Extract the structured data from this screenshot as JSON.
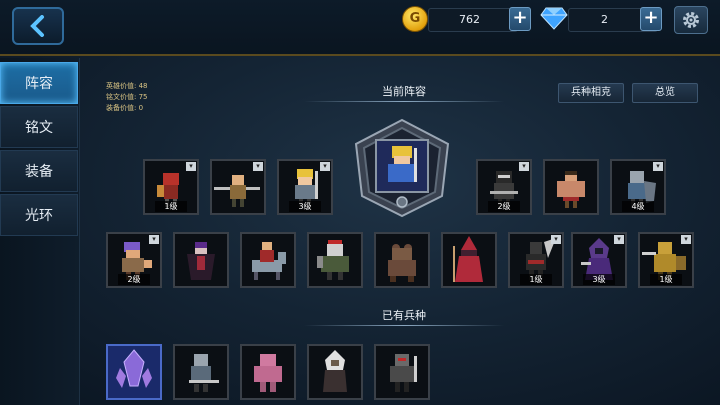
{
  "topbar": {
    "gold": {
      "value": "762",
      "icon": "G"
    },
    "gems": {
      "value": "2"
    },
    "plus": "+"
  },
  "sidebar": {
    "tabs": [
      {
        "label": "阵容",
        "active": true
      },
      {
        "label": "铭文",
        "active": false
      },
      {
        "label": "装备",
        "active": false
      },
      {
        "label": "光环",
        "active": false
      }
    ]
  },
  "stats": {
    "hero_value": "英雄价值: 48",
    "inscription_value": "铭文价值: 75",
    "equipment_value": "装备价值: 0"
  },
  "lineup": {
    "title": "当前阵容",
    "counter_button": "兵种相克",
    "overview_button": "总览",
    "row1_left": [
      {
        "icon": "red-knight-icon",
        "level": "1级"
      },
      {
        "icon": "spear-warrior-icon",
        "level": ""
      },
      {
        "icon": "blonde-knight-icon",
        "level": "3级"
      }
    ],
    "leader": {
      "icon": "leader-hero-icon"
    },
    "row1_right": [
      {
        "icon": "dark-ninja-icon",
        "level": "2级"
      },
      {
        "icon": "barbarian-icon",
        "level": ""
      },
      {
        "icon": "shield-soldier-icon",
        "level": "4级"
      }
    ],
    "row2": [
      {
        "icon": "purple-brawler-icon",
        "level": "2级"
      },
      {
        "icon": "vampire-icon",
        "level": ""
      },
      {
        "icon": "cavalry-icon",
        "level": ""
      },
      {
        "icon": "armored-orc-icon",
        "level": ""
      },
      {
        "icon": "bear-icon",
        "level": ""
      },
      {
        "icon": "red-mage-icon",
        "level": ""
      },
      {
        "icon": "dark-swordsman-icon",
        "level": "1级"
      },
      {
        "icon": "hooded-assassin-icon",
        "level": "3级"
      },
      {
        "icon": "golden-lancer-icon",
        "level": "1级"
      }
    ]
  },
  "owned": {
    "title": "已有兵种",
    "units": [
      {
        "icon": "crystal-icon"
      },
      {
        "icon": "armored-soldier-icon"
      },
      {
        "icon": "pink-brawler-icon"
      },
      {
        "icon": "white-hood-icon"
      },
      {
        "icon": "dark-knight-icon"
      }
    ]
  },
  "colors": {
    "active_tab": "#1d6ea5",
    "gold": "#e2a10d",
    "accent_line": "#5a4a1e"
  }
}
